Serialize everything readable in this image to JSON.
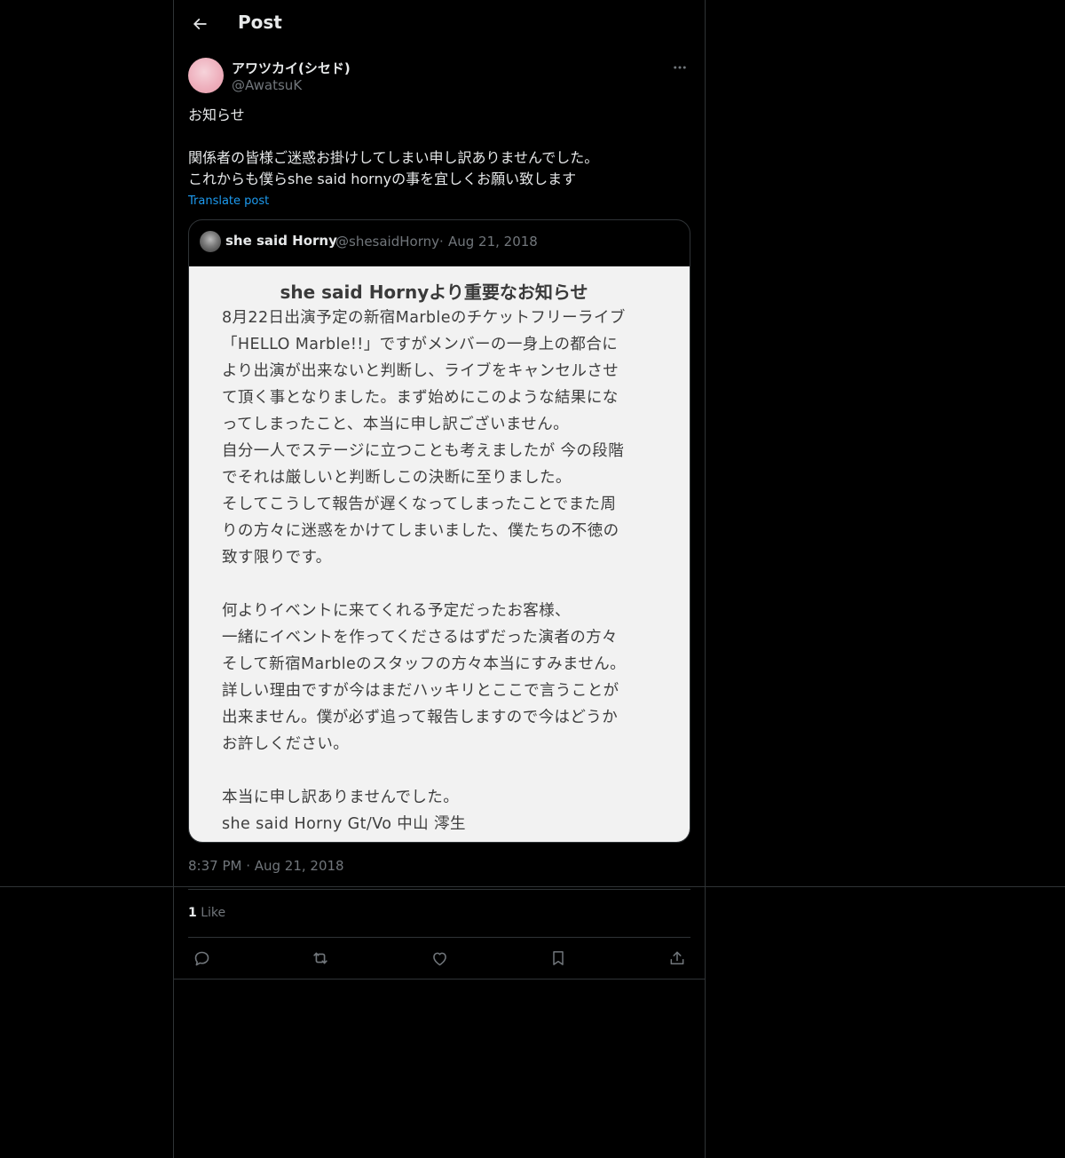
{
  "header": {
    "title": "Post"
  },
  "author": {
    "display_name": "アワツカイ(シセド)",
    "handle": "@AwatsuK"
  },
  "post": {
    "lines": [
      "お知らせ",
      "",
      "関係者の皆様ご迷惑お掛けしてしまい申し訳ありませんでした。",
      "これからも僕らshe said hornyの事を宜しくお願い致します"
    ],
    "translate_label": "Translate post",
    "timestamp": "8:37 PM · Aug 21, 2018"
  },
  "quote": {
    "name": "she said Horny",
    "handle": "@shesaidHorny",
    "separator": "·",
    "date": "Aug 21, 2018",
    "image": {
      "title": "she said Hornyより重要なお知らせ",
      "lines": [
        "8月22日出演予定の新宿Marbleのチケットフリーライブ",
        "「HELLO Marble!!」ですがメンバーの一身上の都合に",
        "より出演が出来ないと判断し、ライブをキャンセルさせ",
        "て頂く事となりました。まず始めにこのような結果にな",
        "ってしまったこと、本当に申し訳ございません。",
        "自分一人でステージに立つことも考えましたが 今の段階",
        "でそれは厳しいと判断しこの決断に至りました。",
        "そしてこうして報告が遅くなってしまったことでまた周",
        "りの方々に迷惑をかけてしまいました、僕たちの不徳の",
        "致す限りです。",
        "",
        "何よりイベントに来てくれる予定だったお客様、",
        "一緒にイベントを作ってくださるはずだった演者の方々",
        "そして新宿Marbleのスタッフの方々本当にすみません。",
        "詳しい理由ですが今はまだハッキリとここで言うことが",
        "出来ません。僕が必ず追って報告しますので今はどうか",
        "お許しください。",
        "",
        "本当に申し訳ありませんでした。",
        "she said Horny Gt/Vo 中山 澪生"
      ]
    }
  },
  "stats": {
    "like_count": "1",
    "like_label": "Like"
  },
  "actions": [
    "reply",
    "repost",
    "like",
    "bookmark",
    "share"
  ],
  "colors": {
    "background": "#000000",
    "text": "#e7e9ea",
    "muted": "#71767b",
    "link": "#1d9bf0",
    "border": "#2f3336"
  }
}
